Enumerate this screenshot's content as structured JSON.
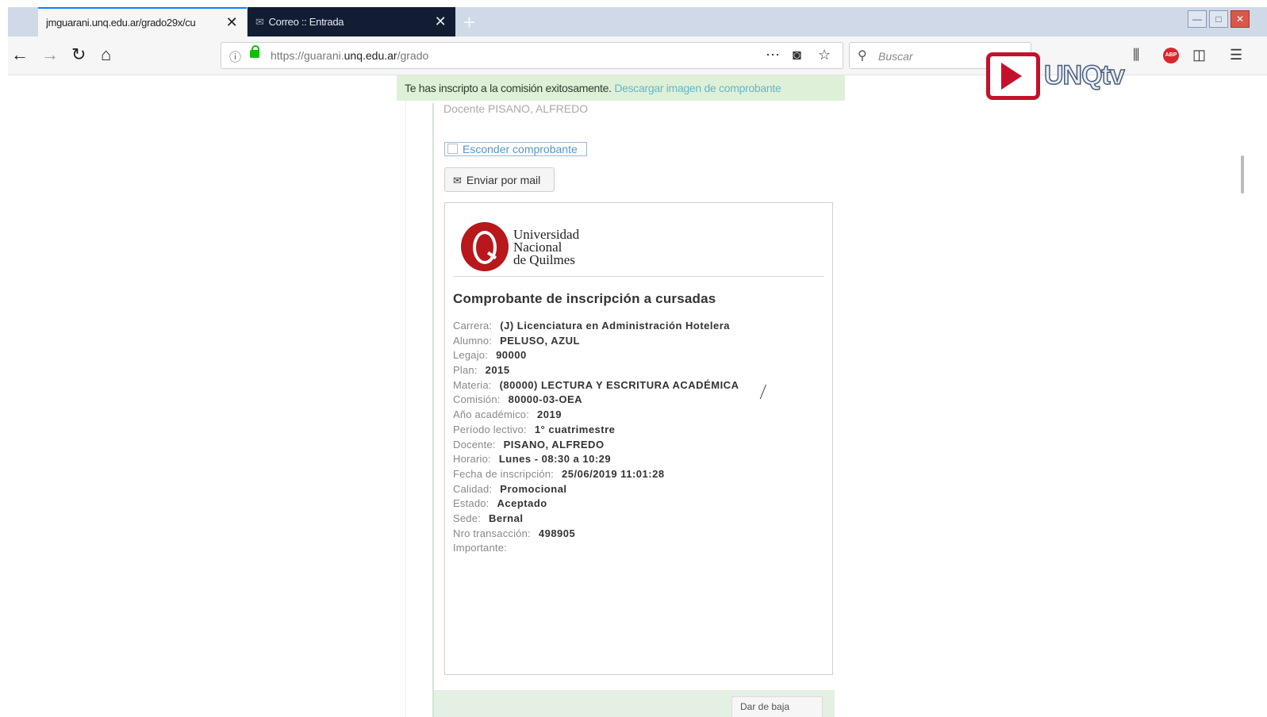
{
  "browser": {
    "tabs": [
      {
        "title": "jmguarani.unq.edu.ar/grado29x/cu",
        "active": true
      },
      {
        "title": "Correo :: Entrada",
        "active": false
      }
    ],
    "new_tab_label": "+",
    "url_prefix": "https://guarani.",
    "url_domain": "unq.edu.ar",
    "url_path": "/grado",
    "search_placeholder": "Buscar",
    "abp_label": "ABP"
  },
  "watermark": {
    "text": "UNQtv"
  },
  "flash": {
    "message": "Te has inscripto a la comisión exitosamente.",
    "link": "Descargar imagen de comprobante"
  },
  "page": {
    "docente_preview": "Docente PISANO, ALFREDO",
    "hide_receipt_link": "Esconder comprobante",
    "email_button": "Enviar por mail",
    "bottom_button": "Dar de baja"
  },
  "receipt": {
    "university": [
      "Universidad",
      "Nacional",
      "de Quilmes"
    ],
    "title": "Comprobante de inscripción a cursadas",
    "fields": [
      {
        "label": "Carrera:",
        "value": "(J) Licenciatura en Administración Hotelera"
      },
      {
        "label": "Alumno:",
        "value": "PELUSO, AZUL"
      },
      {
        "label": "Legajo:",
        "value": "90000"
      },
      {
        "label": "Plan:",
        "value": "2015"
      },
      {
        "label": "Materia:",
        "value": "(80000) LECTURA Y ESCRITURA ACADÉMICA"
      },
      {
        "label": "Comisión:",
        "value": "80000-03-OEA"
      },
      {
        "label": "Año académico:",
        "value": "2019"
      },
      {
        "label": "Período lectivo:",
        "value": "1° cuatrimestre"
      },
      {
        "label": "Docente:",
        "value": "PISANO, ALFREDO"
      },
      {
        "label": "Horario:",
        "value": "Lunes - 08:30 a 10:29"
      },
      {
        "label": "Fecha de inscripción:",
        "value": "25/06/2019 11:01:28"
      },
      {
        "label": "Calidad:",
        "value": "Promocional"
      },
      {
        "label": "Estado:",
        "value": "Aceptado"
      },
      {
        "label": "Sede:",
        "value": "Bernal"
      },
      {
        "label": "Nro transacción:",
        "value": "498905"
      },
      {
        "label": "Importante:",
        "value": ""
      }
    ]
  }
}
